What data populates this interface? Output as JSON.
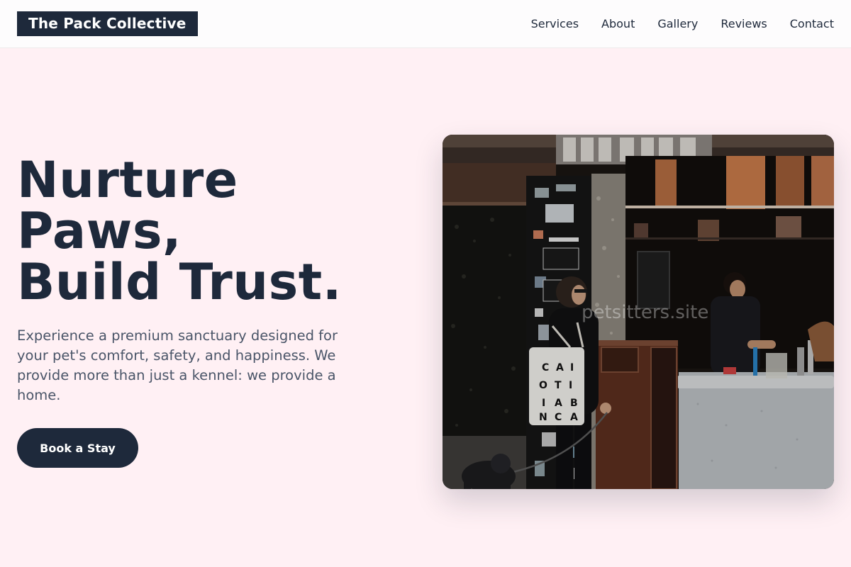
{
  "brand": {
    "name": "The Pack Collective"
  },
  "nav": {
    "items": [
      {
        "label": "Services"
      },
      {
        "label": "About"
      },
      {
        "label": "Gallery"
      },
      {
        "label": "Reviews"
      },
      {
        "label": "Contact"
      }
    ]
  },
  "hero": {
    "title_lines": [
      "Nurture",
      "Paws,",
      "Build Trust."
    ],
    "description": "Experience a premium sanctuary designed for your pet's comfort, safety, and happiness. We provide more than just a kennel: we provide a home.",
    "cta_label": "Book a Stay",
    "image_watermark": "petsitters.site"
  },
  "colors": {
    "page_background": "#fff0f4",
    "primary": "#1e293b",
    "text_muted": "#4a5568"
  }
}
